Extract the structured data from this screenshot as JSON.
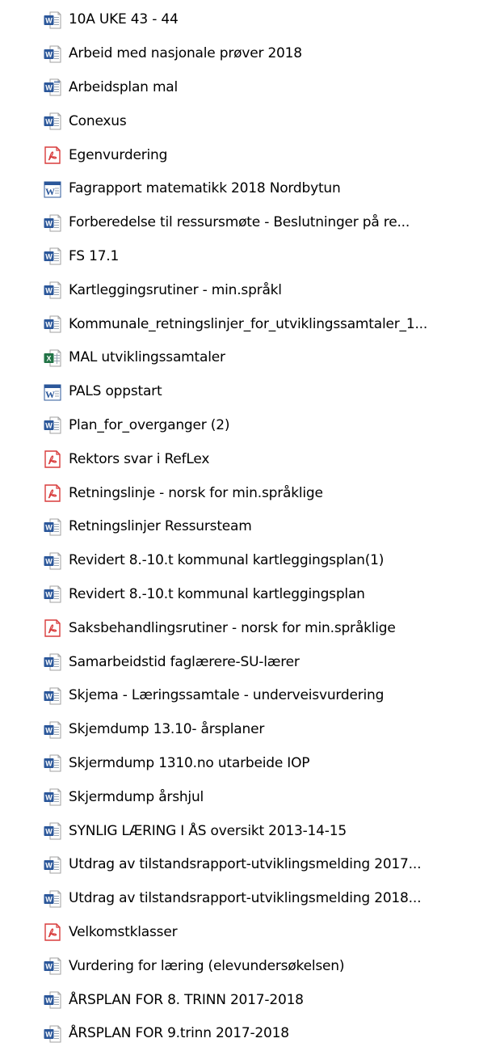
{
  "files": [
    {
      "name": "10A UKE 43 - 44",
      "icon": "word-doc-icon"
    },
    {
      "name": "Arbeid med nasjonale prøver 2018",
      "icon": "word-doc-icon"
    },
    {
      "name": "Arbeidsplan mal",
      "icon": "word-template-icon"
    },
    {
      "name": "Conexus",
      "icon": "word-doc-icon"
    },
    {
      "name": "Egenvurdering",
      "icon": "pdf-icon"
    },
    {
      "name": "Fagrapport matematikk 2018 Nordbytun",
      "icon": "word-legacy-icon"
    },
    {
      "name": "Forberedelse til ressursmøte - Beslutninger på re...",
      "icon": "word-doc-icon"
    },
    {
      "name": "FS 17.1",
      "icon": "word-doc-icon"
    },
    {
      "name": "Kartleggingsrutiner - min.språkl",
      "icon": "word-doc-icon"
    },
    {
      "name": "Kommunale_retningslinjer_for_utviklingssamtaler_1...",
      "icon": "word-doc-icon"
    },
    {
      "name": "MAL utviklingssamtaler",
      "icon": "excel-icon"
    },
    {
      "name": "PALS oppstart",
      "icon": "word-legacy-icon"
    },
    {
      "name": "Plan_for_overganger (2)",
      "icon": "word-doc-icon"
    },
    {
      "name": "Rektors svar i RefLex",
      "icon": "pdf-icon"
    },
    {
      "name": "Retningslinje - norsk for min.språklige",
      "icon": "pdf-icon"
    },
    {
      "name": "Retningslinjer Ressursteam",
      "icon": "word-doc-icon"
    },
    {
      "name": "Revidert 8.-10.t kommunal kartleggingsplan(1)",
      "icon": "word-doc-icon"
    },
    {
      "name": "Revidert 8.-10.t kommunal kartleggingsplan",
      "icon": "word-doc-icon"
    },
    {
      "name": "Saksbehandlingsrutiner - norsk for min.språklige",
      "icon": "pdf-icon"
    },
    {
      "name": "Samarbeidstid faglærere-SU-lærer",
      "icon": "word-doc-icon"
    },
    {
      "name": "Skjema - Læringssamtale - underveisvurdering",
      "icon": "word-doc-icon"
    },
    {
      "name": "Skjemdump 13.10- årsplaner",
      "icon": "word-doc-icon"
    },
    {
      "name": "Skjermdump 1310.no utarbeide IOP",
      "icon": "word-doc-icon"
    },
    {
      "name": "Skjermdump årshjul",
      "icon": "word-doc-icon"
    },
    {
      "name": "SYNLIG LÆRING I ÅS oversikt 2013-14-15",
      "icon": "word-doc-icon"
    },
    {
      "name": "Utdrag av tilstandsrapport-utviklingsmelding 2017...",
      "icon": "word-doc-icon"
    },
    {
      "name": "Utdrag av tilstandsrapport-utviklingsmelding 2018...",
      "icon": "word-doc-icon"
    },
    {
      "name": "Velkomstklasser",
      "icon": "pdf-icon"
    },
    {
      "name": "Vurdering for læring (elevundersøkelsen)",
      "icon": "word-doc-icon"
    },
    {
      "name": "ÅRSPLAN FOR 8. TRINN 2017-2018",
      "icon": "word-doc-icon"
    },
    {
      "name": "ÅRSPLAN FOR 9.trinn 2017-2018",
      "icon": "word-doc-icon"
    }
  ],
  "colors": {
    "word": "#2b579a",
    "pdf": "#d83b3b",
    "excel": "#217346",
    "page": "#ffffff",
    "page_border": "#a0a0a0",
    "page_lines": "#9aa6b4"
  }
}
